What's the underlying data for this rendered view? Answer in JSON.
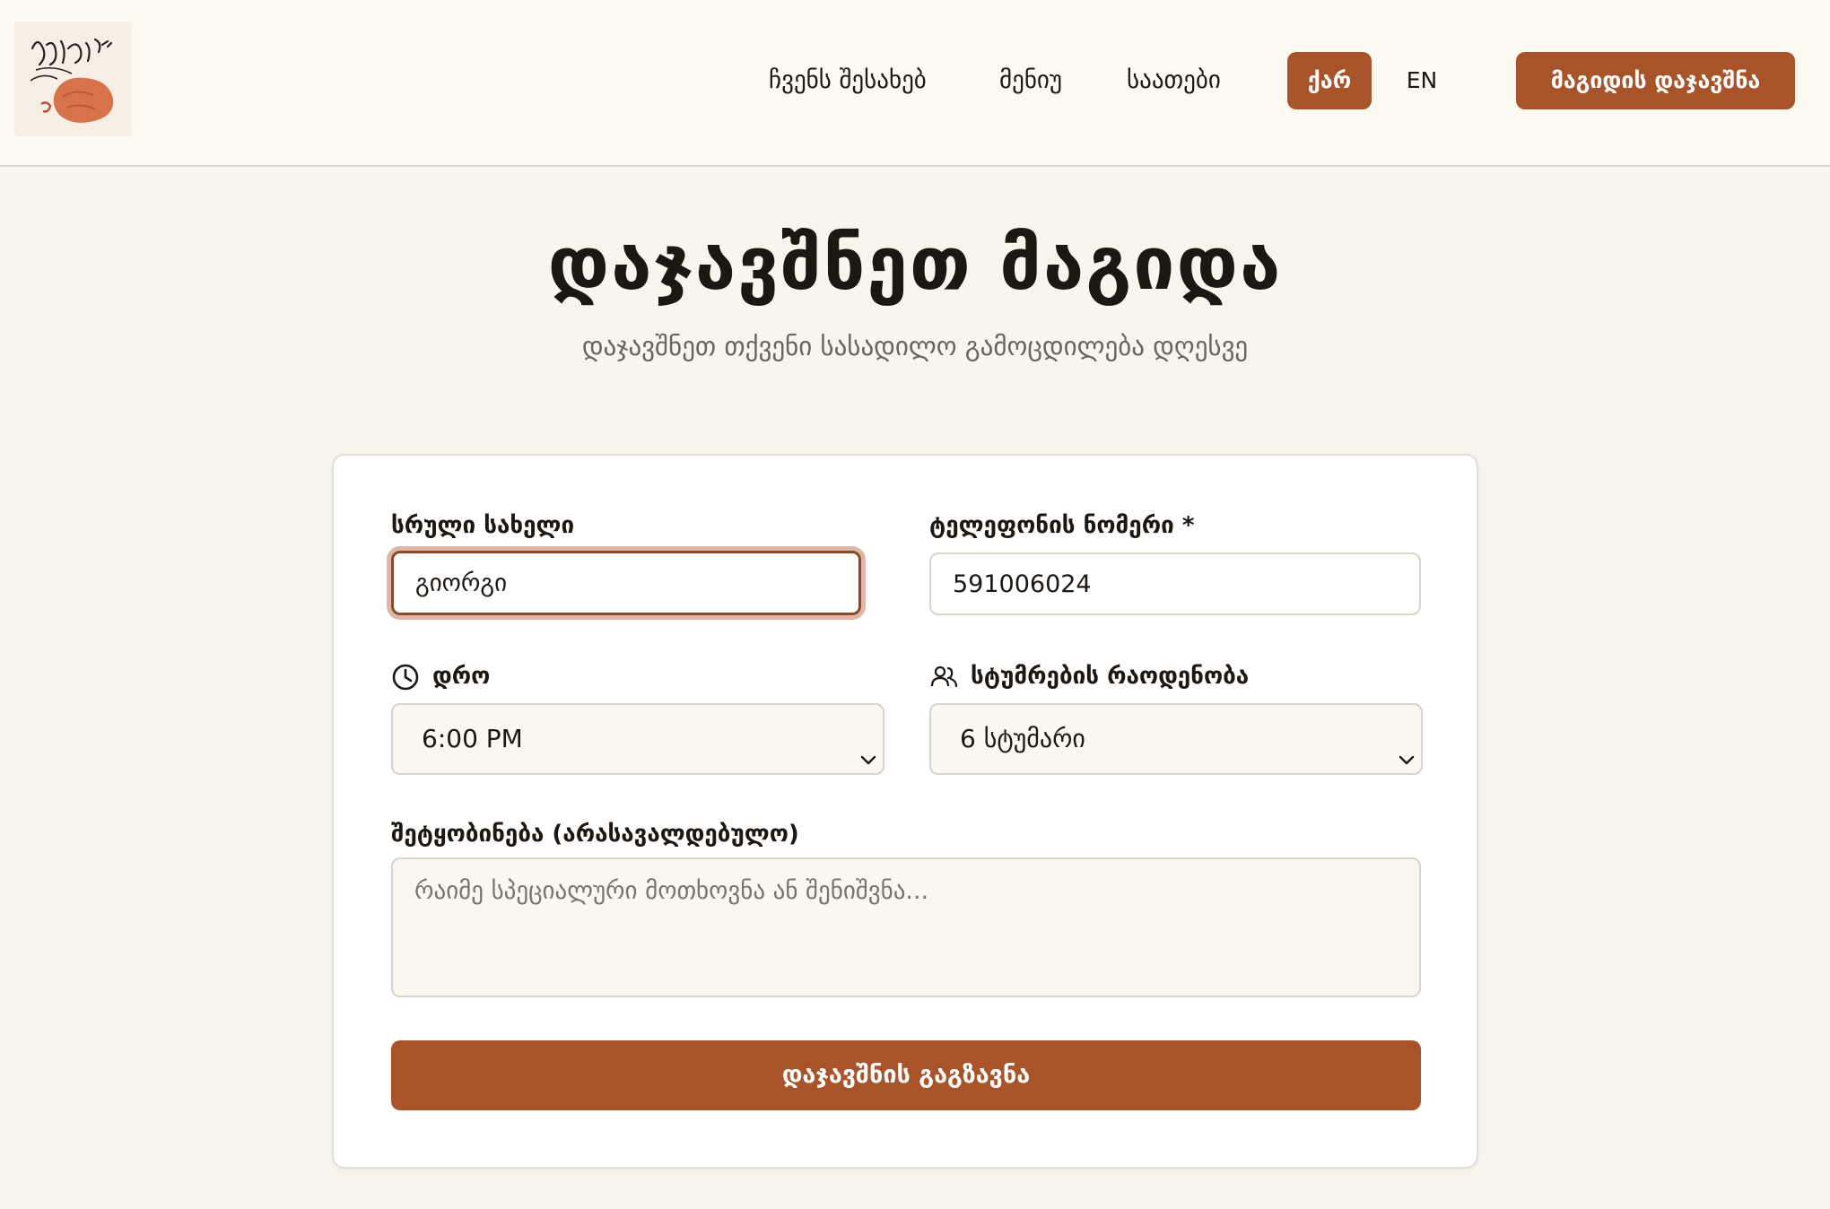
{
  "header": {
    "nav": [
      "ჩვენს შესახებ",
      "მენიუ",
      "საათები"
    ],
    "lang_active": "ქარ",
    "lang_other": "EN",
    "cta_label": "მაგიდის დაჯავშნა"
  },
  "hero": {
    "title": "დაჯავშნეთ მაგიდა",
    "subtitle": "დაჯავშნეთ თქვენი სასადილო გამოცდილება დღესვე"
  },
  "form": {
    "full_name_label": "სრული სახელი",
    "full_name_value": "გიორგი",
    "phone_label": "ტელეფონის ნომერი *",
    "phone_value": "591006024",
    "time_label": "დრო",
    "time_value": "6:00 PM",
    "guests_label": "სტუმრების რაოდენობა",
    "guests_value": "6 სტუმარი",
    "message_label": "შეტყობინება (არასავალდებულო)",
    "message_placeholder": "რაიმე სპეციალური მოთხოვნა ან შენიშვნა...",
    "submit_label": "დაჯავშნის გაგზავნა"
  },
  "icons": {
    "time_icon": "clock-icon",
    "guests_icon": "users-icon",
    "select_icon": "chevron-down-icon"
  },
  "colors": {
    "accent": "#a9532a",
    "background": "#f8f5ef",
    "header_bg": "#fcf9f3"
  }
}
